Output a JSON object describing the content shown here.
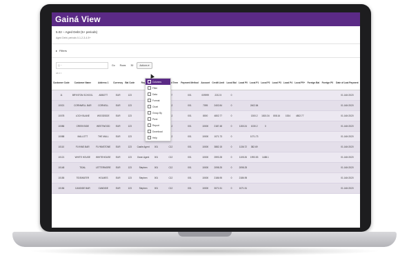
{
  "app": {
    "brand": "Gainá View"
  },
  "report": {
    "title": "5.02 – Aged Debt (5+ periods)",
    "subtitle": "Aged Debt, periods 0-1-2-3-4-5+"
  },
  "filters_label": "Filters",
  "toolbar": {
    "search_placeholder": "Q ~",
    "go_label": "Go",
    "rows_label": "Rows",
    "rows_value": "30",
    "actions_label": "Actions"
  },
  "breadcrumb": "All 2 ×",
  "actions_menu": {
    "items": [
      "Columns",
      "Filter",
      "Data",
      "Format",
      "Chart",
      "Group By",
      "Pivot",
      "Report",
      "Download",
      "Help"
    ]
  },
  "table": {
    "headers": [
      "Customer Code",
      "Customer Name",
      "Address 1",
      "Currency",
      "Bal Code",
      "Rep",
      "Bill Type",
      "Payment Term",
      "Payment Method",
      "Account",
      "Credit Limit",
      "Local Bal",
      "Local P0",
      "Local P1",
      "Local P2",
      "Local P3",
      "Local P4",
      "Local P5+",
      "Foreign Bal",
      "Foreign P0",
      "Date of Last Payment"
    ],
    "rows": [
      [
        "11",
        "BRYNTON SCHOOL",
        "ABBOTT",
        "EUR",
        "123",
        "",
        "001",
        "007",
        "001",
        "009999",
        "2212.5",
        "0",
        "",
        "",
        "",
        "",
        "",
        "",
        "",
        "",
        "01 JAN 2020"
      ],
      [
        "10021",
        "CORNWELL BAR",
        "CORNELL",
        "EUR",
        "123",
        "",
        "001",
        "C12",
        "001",
        "7095",
        "2402.84",
        "0",
        "",
        "2402.84",
        "",
        "",
        "",
        "",
        "",
        "",
        "01 JAN 2020"
      ],
      [
        "10078",
        "LOCH BLANE",
        "WOODSIDE",
        "EUR",
        "123",
        "",
        "001",
        "C12",
        "001",
        "8000",
        "4802.77",
        "0",
        "",
        "1300.2",
        "1815.34",
        "808.16",
        "1534",
        "4802.77",
        "",
        "",
        "01 JAN 2020"
      ],
      [
        "10086",
        "CREEKSIDE",
        "WESTWOOD",
        "EUR",
        "123",
        "",
        "001",
        "C12",
        "001",
        "10000",
        "2187.48",
        "0",
        "1150.24",
        "1030.2",
        "0",
        "",
        "",
        "",
        "",
        "",
        "01 JAN 2020"
      ],
      [
        "10088",
        "MALLOTT",
        "THE MALL",
        "EUR",
        "123",
        "",
        "001",
        "C12",
        "001",
        "10000",
        "1071.73",
        "0",
        "",
        "1071.73",
        "",
        "",
        "",
        "",
        "",
        "",
        "01 JAN 2020"
      ],
      [
        "10110",
        "FLYNNS BAR",
        "FLYNNSTONE",
        "EUR",
        "123",
        "Castle Agent",
        "001",
        "C12",
        "001",
        "10000",
        "3882.15",
        "0",
        "1136.72",
        "382.69",
        "",
        "",
        "",
        "",
        "",
        "",
        "01 JAN 2020"
      ],
      [
        "10121",
        "WHITE HOUSE",
        "WHITEHOUSE",
        "EUR",
        "123",
        "Owen Agent",
        "001",
        "C12",
        "001",
        "10000",
        "2593.28",
        "0",
        "1105.26",
        "1993.53",
        "1488.1",
        "",
        "",
        "",
        "",
        "",
        "01 JAN 2020"
      ],
      [
        "10148",
        "TIDAL",
        "LETTERMORE",
        "EUR",
        "123",
        "Stephen",
        "001",
        "C12",
        "001",
        "10000",
        "2098.25",
        "0",
        "2098.25",
        "",
        "",
        "",
        "",
        "",
        "",
        "",
        "01 JAN 2020"
      ],
      [
        "10155",
        "TIDEWATER",
        "HOLMES",
        "EUR",
        "123",
        "Stephen",
        "001",
        "C12",
        "001",
        "10000",
        "2186.95",
        "0",
        "2186.95",
        "",
        "",
        "",
        "",
        "",
        "",
        "",
        "01 JAN 2020"
      ],
      [
        "10156",
        "CANDIDE BAR",
        "CANDIDE",
        "EUR",
        "123",
        "Stephen",
        "001",
        "C12",
        "001",
        "10000",
        "3071.51",
        "0",
        "1071.51",
        "",
        "",
        "",
        "",
        "",
        "",
        "",
        "01 JAN 2020"
      ]
    ]
  }
}
